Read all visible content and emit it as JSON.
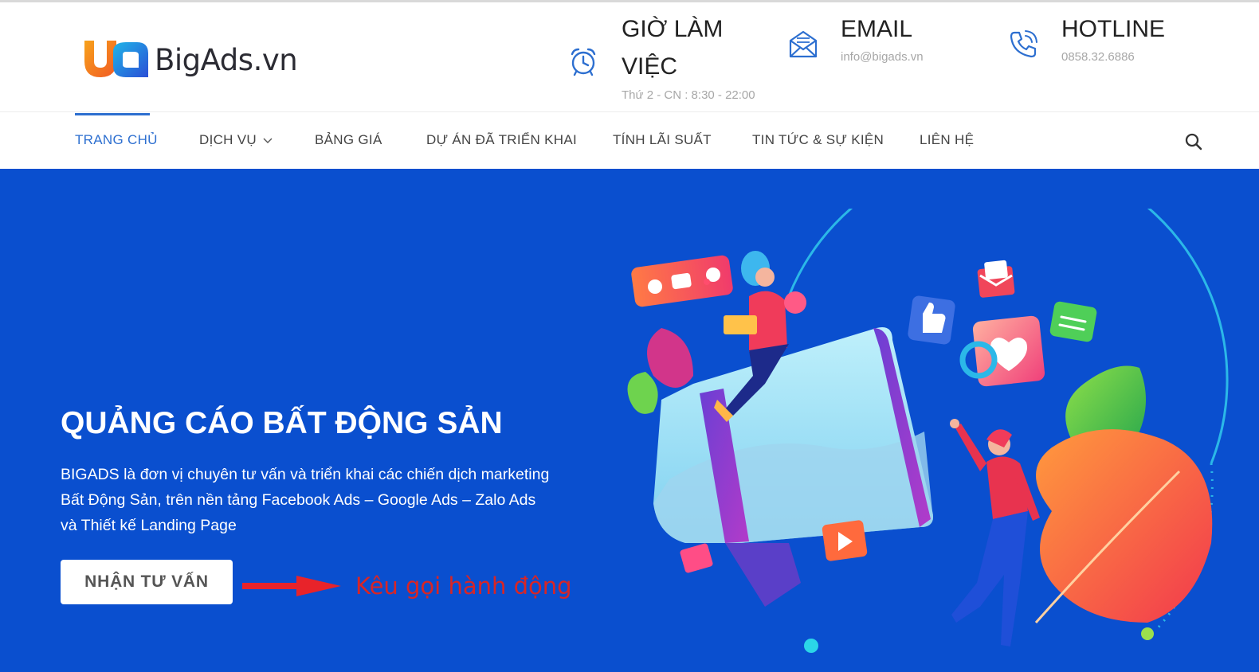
{
  "brand": {
    "logo_text": "BigAds.vn",
    "colors": {
      "primary_blue": "#0a4fcf",
      "nav_active": "#2d6fd0",
      "callout_red": "#d92525"
    }
  },
  "header": {
    "hours": {
      "icon": "alarm-clock-icon",
      "title_line1": "GIỜ LÀM",
      "title_line2": "VIỆC",
      "subtitle": "Thứ 2 - CN : 8:30 - 22:00"
    },
    "email": {
      "icon": "envelope-icon",
      "title": "EMAIL",
      "subtitle": "info@bigads.vn"
    },
    "hotline": {
      "icon": "phone-icon",
      "title": "HOTLINE",
      "subtitle": "0858.32.6886"
    }
  },
  "nav": {
    "items": [
      {
        "label": "TRANG CHỦ",
        "active": true
      },
      {
        "label": "DỊCH VỤ",
        "has_dropdown": true
      },
      {
        "label": "BẢNG GIÁ"
      },
      {
        "label": "DỰ ÁN ĐÃ TRIỂN KHAI"
      },
      {
        "label": "TÍNH LÃI SUẤT"
      },
      {
        "label": "TIN TỨC & SỰ KIỆN"
      },
      {
        "label": "LIÊN HỆ"
      }
    ],
    "search_icon": "search-icon"
  },
  "hero": {
    "title": "QUẢNG CÁO BẤT ĐỘNG SẢN",
    "desc_line1": "BIGADS là đơn vị chuyên tư vấn và triển khai các chiến dịch marketing",
    "desc_line2": "Bất Động Sản, trên nền tảng Facebook Ads – Google Ads – Zalo Ads",
    "desc_line3": "và Thiết kế Landing Page",
    "cta_label": "NHẬN TƯ VẤN",
    "callout": "Kêu gọi hành động"
  }
}
